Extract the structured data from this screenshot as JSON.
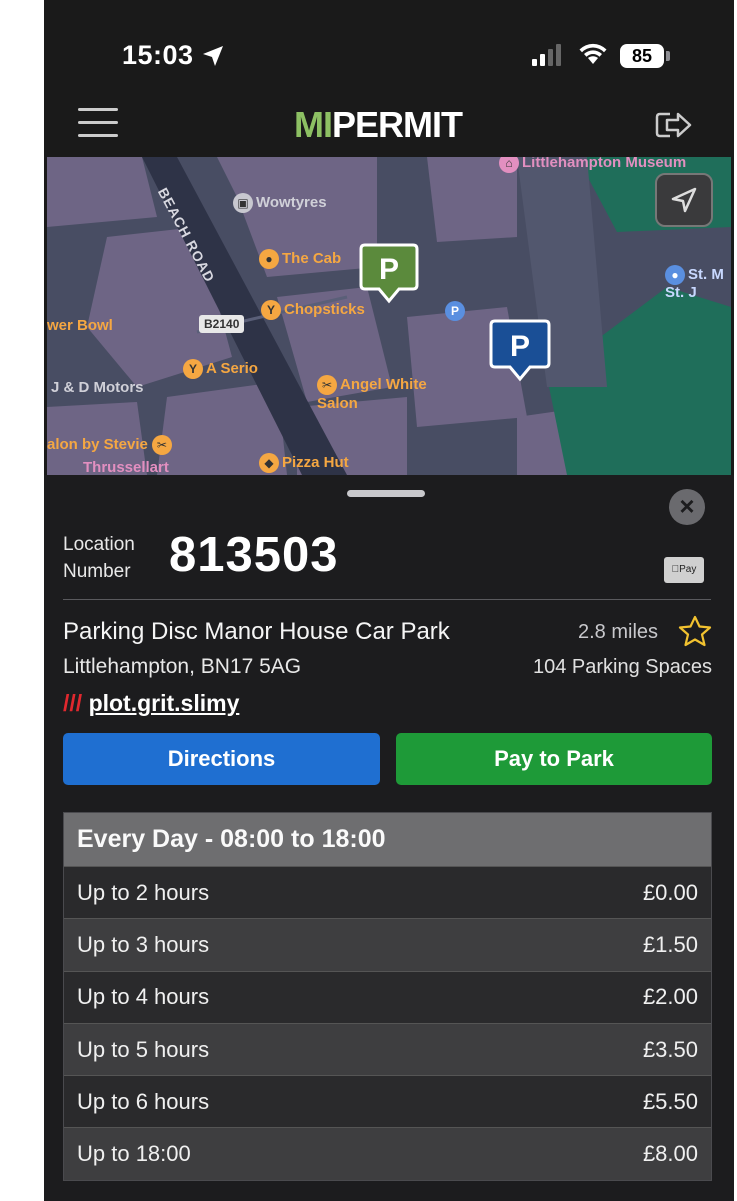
{
  "status_bar": {
    "time": "15:03",
    "battery": "85"
  },
  "header": {
    "logo_mi": "MI",
    "logo_permit": "PERMIT"
  },
  "map": {
    "road_name": "BEACH ROAD",
    "road_badge": "B2140",
    "pois": [
      {
        "label": "Littlehampton Museum"
      },
      {
        "label": "Wowtyres"
      },
      {
        "label": "The Cab"
      },
      {
        "label": "Chopsticks"
      },
      {
        "label": "wer Bowl"
      },
      {
        "label": "A Serio"
      },
      {
        "label": "J & D Motors"
      },
      {
        "label": "Angel White Salon"
      },
      {
        "label": "alon by Stevie"
      },
      {
        "label": "Pizza Hut"
      },
      {
        "label": "Thrussellart"
      },
      {
        "label": "St. M St. J"
      }
    ],
    "pin_label": "P",
    "small_p": "P",
    "colors": {
      "pin_green": "#5b8a3c",
      "pin_blue": "#1a4f96"
    }
  },
  "sheet": {
    "location_label_1": "Location",
    "location_label_2": "Number",
    "location_number": "813503",
    "apple_pay": "Pay",
    "park_name": "Parking Disc Manor House Car Park",
    "address": "Littlehampton, BN17 5AG",
    "distance": "2.8 miles",
    "spaces": "104 Parking Spaces",
    "w3w_slashes": "///",
    "w3w_words": "plot.grit.slimy",
    "directions_label": "Directions",
    "pay_label": "Pay to Park",
    "close": "×"
  },
  "tariff": {
    "heading": "Every Day - 08:00 to 18:00",
    "rows": [
      {
        "duration": "Up to 2 hours",
        "price": "£0.00"
      },
      {
        "duration": "Up to 3 hours",
        "price": "£1.50"
      },
      {
        "duration": "Up to 4 hours",
        "price": "£2.00"
      },
      {
        "duration": "Up to 5 hours",
        "price": "£3.50"
      },
      {
        "duration": "Up to 6 hours",
        "price": "£5.50"
      },
      {
        "duration": "Up to 18:00",
        "price": "£8.00"
      }
    ]
  },
  "colors": {
    "accent_green": "#8dc063",
    "directions_blue": "#1f6fd1",
    "pay_green": "#1e9a38",
    "w3w_red": "#e0282e"
  },
  "icons": [
    "location-arrow-icon",
    "signal-icon",
    "wifi-icon",
    "battery-icon",
    "menu-icon",
    "logout-icon",
    "locate-icon",
    "star-icon",
    "close-icon",
    "parking-pin-icon"
  ]
}
